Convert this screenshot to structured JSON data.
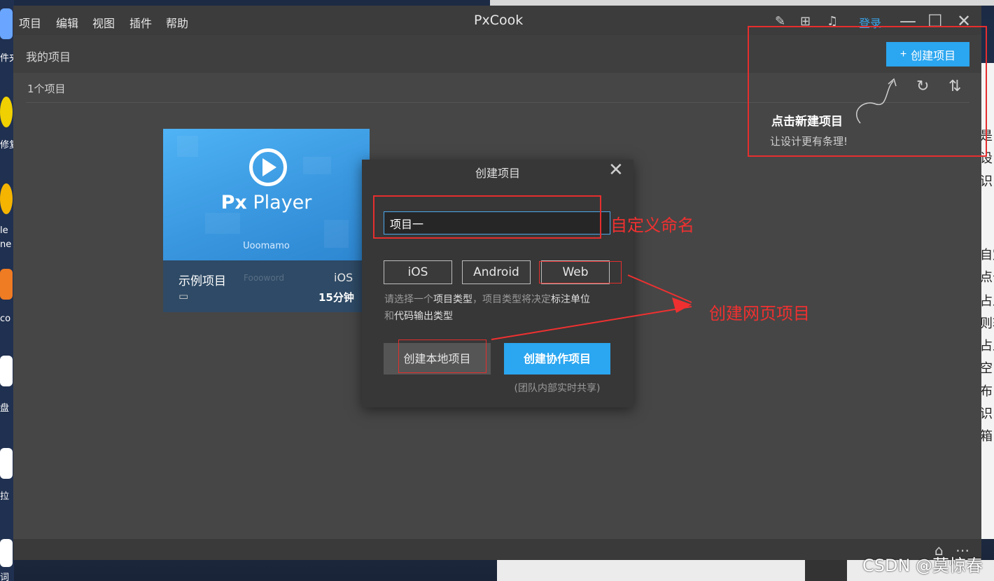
{
  "window": {
    "title": "PxCook"
  },
  "menu": [
    "项目",
    "编辑",
    "视图",
    "插件",
    "帮助"
  ],
  "toolbar": {
    "login_label": "登录",
    "icons": [
      "pen-icon",
      "gift-icon",
      "bell-icon"
    ],
    "window_controls": [
      "—",
      "☐",
      "✕"
    ]
  },
  "header": {
    "my_projects_label": "我的项目",
    "create_button_label": "创建项目",
    "project_count_label": "1个项目"
  },
  "tip": {
    "title": "点击新建项目",
    "subtitle": "让设计更有条理!"
  },
  "project_card": {
    "cover_title_bold": "Px",
    "cover_title_rest": " Player",
    "cover_author": "Uoomamo",
    "name": "示例项目",
    "watermark": "Foooword",
    "platform": "iOS",
    "time": "15分钟"
  },
  "dialog": {
    "title": "创建项目",
    "name_value": "项目一",
    "platform_options": [
      "iOS",
      "Android",
      "Web"
    ],
    "hint_prefix": "请选择一个",
    "hint_type": "项目类型",
    "hint_middle": "，项目类型将决定",
    "hint_unit": "标注单位",
    "hint_and": "和",
    "hint_code": "代码输出类型",
    "local_button_label": "创建本地项目",
    "collab_button_label": "创建协作项目",
    "collab_note": "(团队内部实时共享)"
  },
  "annotations": {
    "custom_name": "自定义命名",
    "create_web": "创建网页项目"
  },
  "desktop": {
    "left_labels": [
      "件夹",
      "修复",
      "le",
      "ne",
      "co",
      "盘",
      "拉",
      "词"
    ],
    "right_doc_chars": [
      "是",
      "设",
      "识",
      "自定",
      "点击",
      "占上",
      "则软",
      "占上",
      "空",
      "布",
      "识",
      "箱"
    ]
  },
  "watermark": "CSDN @莫惊春",
  "colors": {
    "accent": "#2ba6f0",
    "annotation": "#e62e2e",
    "window_bg": "#464646"
  }
}
